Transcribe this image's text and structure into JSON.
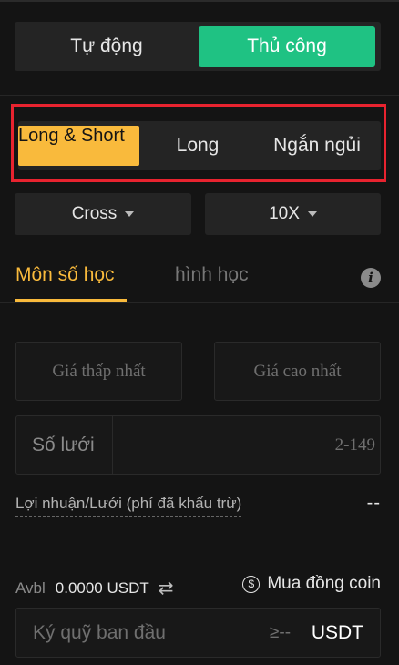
{
  "mode_tabs": {
    "auto": "Tự động",
    "manual": "Thủ công"
  },
  "direction_tabs": {
    "long_short": "Long & Short",
    "long": "Long",
    "short": "Ngắn ngủi"
  },
  "margin_mode": "Cross",
  "leverage": "10X",
  "strategy_tabs": {
    "arithmetic": "Môn số học",
    "geometric": "hình học"
  },
  "info_glyph": "i",
  "price_range": {
    "low_placeholder": "Giá thấp nhất",
    "high_placeholder": "Giá cao nhất"
  },
  "grid": {
    "label": "Số lưới",
    "placeholder": "2-149"
  },
  "profit": {
    "label": "Lợi nhuận/Lưới (phí đã khấu trừ)",
    "value": "--"
  },
  "available": {
    "label": "Avbl",
    "value": "0.0000 USDT",
    "swap_icon_glyph": "⇄"
  },
  "buy_coin": {
    "label": "Mua đồng coin",
    "icon_glyph": "$"
  },
  "margin": {
    "placeholder": "Ký quỹ ban đầu",
    "hint": "≥--",
    "unit": "USDT"
  },
  "colors": {
    "accent": "#f9ba3c",
    "manual_active": "#1fc283",
    "highlight_box": "#e8232f",
    "background": "#141414"
  }
}
